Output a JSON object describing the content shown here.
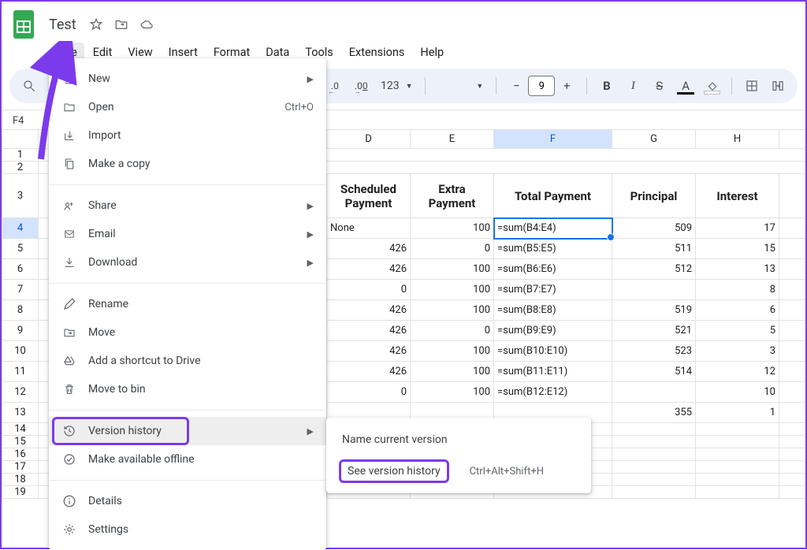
{
  "doc": {
    "title": "Test"
  },
  "menubar": [
    "File",
    "Edit",
    "View",
    "Insert",
    "Format",
    "Data",
    "Tools",
    "Extensions",
    "Help"
  ],
  "toolbar": {
    "dec_decimal": ".0",
    "inc_decimal": ".00",
    "number_format": "123",
    "font_size": "9",
    "minus": "−",
    "plus": "+"
  },
  "namebox": "F4",
  "file_menu": {
    "new": "New",
    "open": "Open",
    "open_shortcut": "Ctrl+O",
    "import": "Import",
    "make_copy": "Make a copy",
    "share": "Share",
    "email": "Email",
    "download": "Download",
    "rename": "Rename",
    "move": "Move",
    "add_shortcut": "Add a shortcut to Drive",
    "bin": "Move to bin",
    "version_history": "Version history",
    "offline": "Make available offline",
    "details": "Details",
    "settings": "Settings"
  },
  "submenu": {
    "name_current": "Name current version",
    "see_history": "See version history",
    "shortcut": "Ctrl+Alt+Shift+H"
  },
  "columns": [
    "D",
    "E",
    "F",
    "G",
    "H"
  ],
  "headers": {
    "d": "Scheduled Payment",
    "e": "Extra Payment",
    "f": "Total Payment",
    "g": "Principal",
    "h": "Interest"
  },
  "rows": [
    {
      "n": 4,
      "d": "None",
      "e": "100",
      "f": "=sum(B4:E4)",
      "g": "509",
      "h": "17"
    },
    {
      "n": 5,
      "d": "426",
      "e": "0",
      "f": "=sum(B5:E5)",
      "g": "511",
      "h": "15"
    },
    {
      "n": 6,
      "d": "426",
      "e": "100",
      "f": "=sum(B6:E6)",
      "g": "512",
      "h": "13"
    },
    {
      "n": 7,
      "d": "0",
      "e": "100",
      "f": "=sum(B7:E7)",
      "g": "",
      "h": "8"
    },
    {
      "n": 8,
      "d": "426",
      "e": "100",
      "f": "=sum(B8:E8)",
      "g": "519",
      "h": "6"
    },
    {
      "n": 9,
      "d": "426",
      "e": "0",
      "f": "=sum(B9:E9)",
      "g": "521",
      "h": "5"
    },
    {
      "n": 10,
      "d": "426",
      "e": "100",
      "f": "=sum(B10:E10)",
      "g": "523",
      "h": "3"
    },
    {
      "n": 11,
      "d": "426",
      "e": "100",
      "f": "=sum(B11:E11)",
      "g": "514",
      "h": "12"
    },
    {
      "n": 12,
      "d": "0",
      "e": "100",
      "f": "=sum(B12:E12)",
      "g": "",
      "h": "10"
    },
    {
      "n": 13,
      "d": "",
      "e": "",
      "f": "",
      "g": "355",
      "h": "1"
    }
  ]
}
